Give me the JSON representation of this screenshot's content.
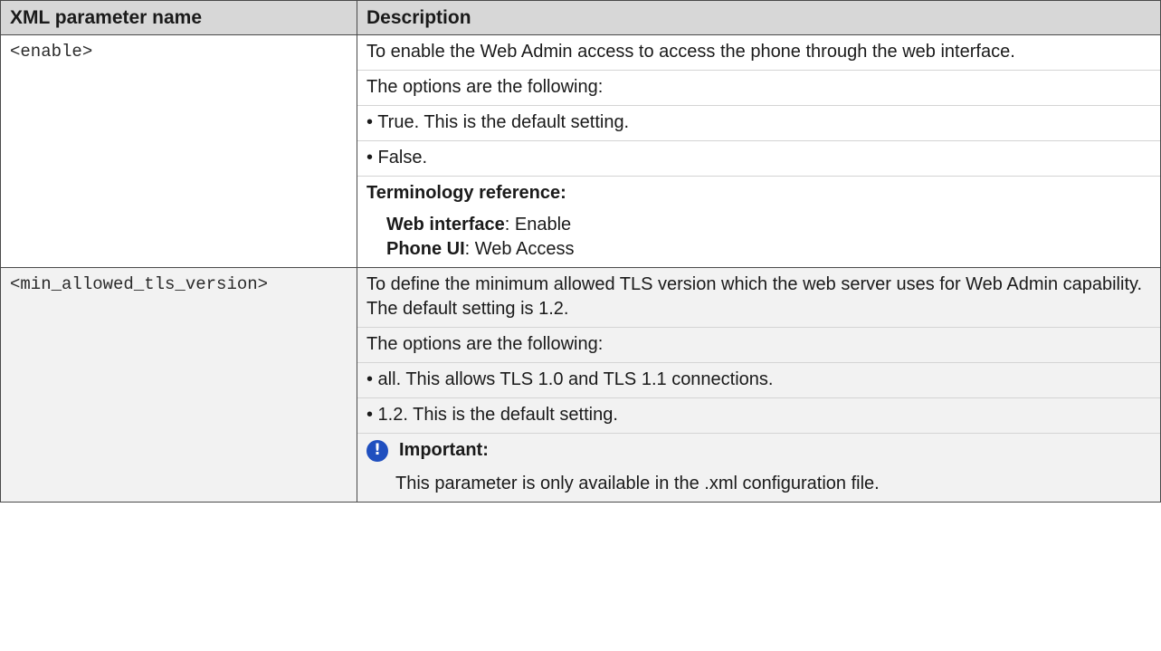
{
  "header": {
    "col1": "XML parameter name",
    "col2": "Description"
  },
  "rows": [
    {
      "name": "<enable>",
      "description": "To enable the Web Admin access to access the phone through the web interface.",
      "options_intro": "The options are the following:",
      "options": [
        "• True. This is the default setting.",
        "• False."
      ],
      "terminology_heading": "Terminology reference:",
      "terminology": [
        {
          "label": "Web interface",
          "value": ": Enable"
        },
        {
          "label": "Phone UI",
          "value": ": Web Access"
        }
      ]
    },
    {
      "name": "<min_allowed_tls_version>",
      "description": "To define the minimum allowed TLS version which the web server uses for Web Admin capability. The default setting is 1.2.",
      "options_intro": "The options are the following:",
      "options": [
        "• all. This allows TLS 1.0 and TLS 1.1 connections.",
        "• 1.2. This is the default setting."
      ],
      "note": {
        "icon": "important-icon",
        "heading": "Important:",
        "text": "This parameter is only available in the .xml configuration file."
      }
    }
  ],
  "colors": {
    "header_bg": "#d7d7d7",
    "alt_row_bg": "#f2f2f2",
    "important_icon": "#1f4fbf"
  }
}
